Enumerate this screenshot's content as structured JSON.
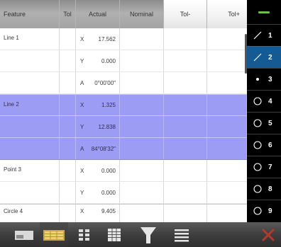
{
  "table": {
    "columns": {
      "feature": "Feature",
      "tol": "Tol",
      "actual": "Actual",
      "nominal": "Nominal",
      "tol_minus": "Tol-",
      "tol_plus": "Tol+"
    },
    "rows": [
      {
        "feature": "Line 1",
        "axis": "X",
        "actual": "17.562",
        "selected": false
      },
      {
        "feature": "",
        "axis": "Y",
        "actual": "0.000",
        "selected": false
      },
      {
        "feature": "",
        "axis": "A",
        "actual": "0°00'00\"",
        "selected": false
      },
      {
        "feature": "Line 2",
        "axis": "X",
        "actual": "1.325",
        "selected": true
      },
      {
        "feature": "",
        "axis": "Y",
        "actual": "12.838",
        "selected": true
      },
      {
        "feature": "",
        "axis": "A",
        "actual": "84°08'32\"",
        "selected": true
      },
      {
        "feature": "Point 3",
        "axis": "X",
        "actual": "0.000",
        "selected": false
      },
      {
        "feature": "",
        "axis": "Y",
        "actual": "0.000",
        "selected": false
      },
      {
        "feature": "Circle 4",
        "axis": "X",
        "actual": "9.405",
        "selected": false
      }
    ]
  },
  "feature_list": {
    "items": [
      {
        "number": "1",
        "icon": "line-icon",
        "active": false
      },
      {
        "number": "2",
        "icon": "line-icon",
        "active": true
      },
      {
        "number": "3",
        "icon": "point-icon",
        "active": false
      },
      {
        "number": "4",
        "icon": "circle-icon",
        "active": false
      },
      {
        "number": "5",
        "icon": "circle-icon",
        "active": false
      },
      {
        "number": "6",
        "icon": "circle-icon",
        "active": false
      },
      {
        "number": "7",
        "icon": "circle-icon",
        "active": false
      },
      {
        "number": "8",
        "icon": "circle-icon",
        "active": false
      },
      {
        "number": "9",
        "icon": "circle-icon",
        "active": false
      }
    ]
  },
  "toolbar": {
    "buttons": [
      {
        "icon": "single-view-icon"
      },
      {
        "icon": "table-view-icon",
        "active": true
      },
      {
        "icon": "data-grid-icon"
      },
      {
        "icon": "spreadsheet-icon"
      },
      {
        "icon": "funnel-icon"
      },
      {
        "icon": "list-icon"
      },
      {
        "icon": "delete-x-icon"
      }
    ]
  },
  "colors": {
    "selection": "#9d9cf4",
    "active_feature": "#155a93",
    "accent_green": "#6dbf4b",
    "delete_red": "#c0392b"
  }
}
